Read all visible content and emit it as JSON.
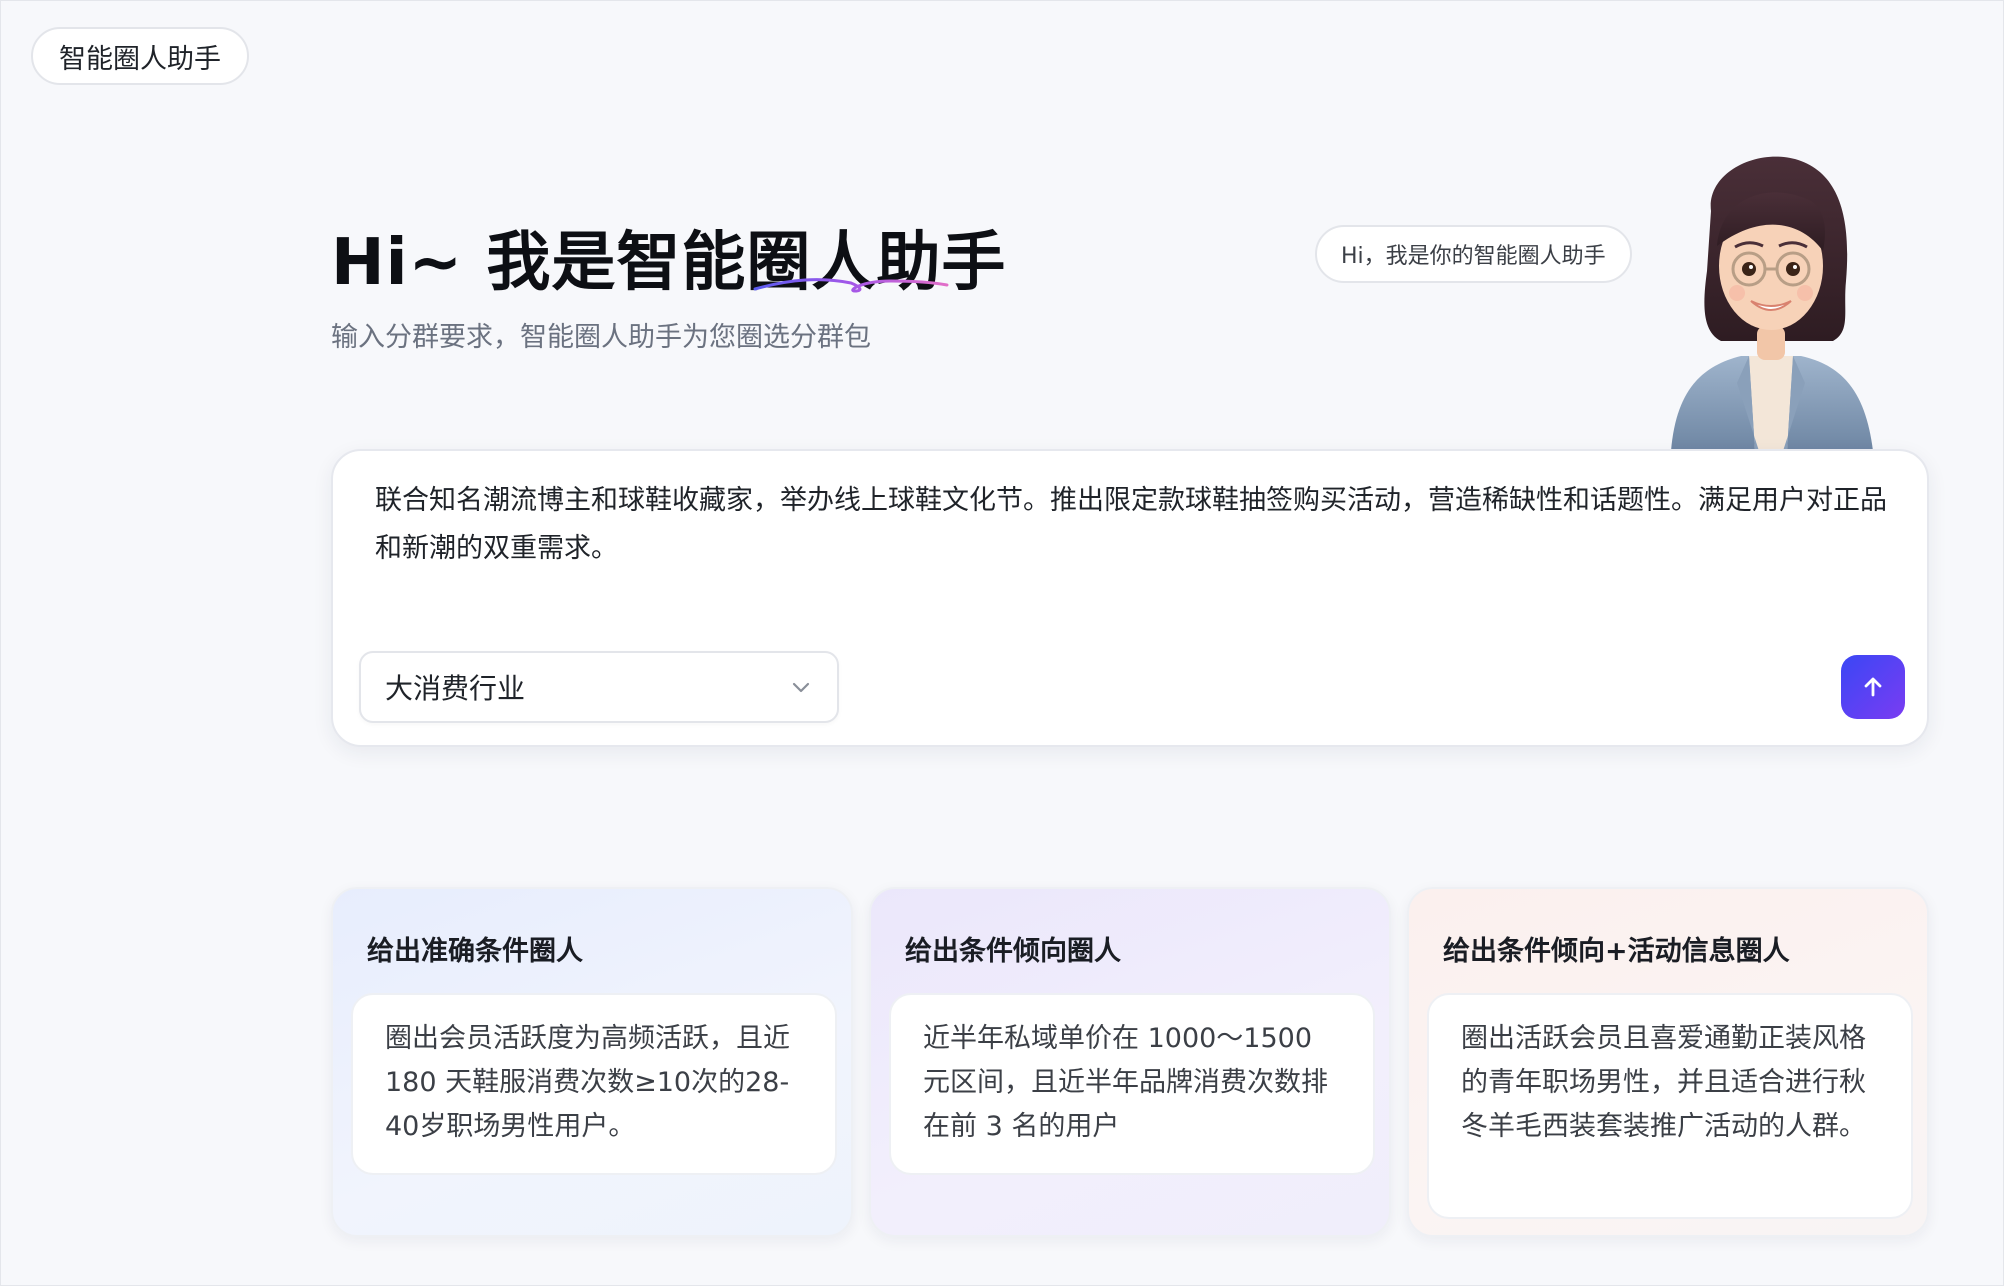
{
  "app": {
    "tag_label": "智能圈人助手"
  },
  "hero": {
    "title": "Hi~ 我是智能圈人助手",
    "subtitle": "输入分群要求，智能圈人助手为您圈选分群包"
  },
  "assistant": {
    "greeting": "Hi，我是你的智能圈人助手",
    "avatar_icon": "assistant-avatar-icon"
  },
  "input": {
    "text": "联合知名潮流博主和球鞋收藏家，举办线上球鞋文化节。推出限定款球鞋抽签购买活动，营造稀缺性和话题性。满足用户对正品和新潮的双重需求。",
    "industry_selected": "大消费行业",
    "send_icon": "arrow-up-icon",
    "accent_color": "#4a44f3"
  },
  "examples": [
    {
      "title": "给出准确条件圈人",
      "body": "圈出会员活跃度为高频活跃，且近 180 天鞋服消费次数≥10次的28-40岁职场男性用户。"
    },
    {
      "title": "给出条件倾向圈人",
      "body": "近半年私域单价在 1000～1500 元区间，且近半年品牌消费次数排在前 3 名的用户"
    },
    {
      "title": "给出条件倾向+活动信息圈人",
      "body": "圈出活跃会员且喜爱通勤正装风格的青年职场男性，并且适合进行秋冬羊毛西装套装推广活动的人群。"
    }
  ]
}
